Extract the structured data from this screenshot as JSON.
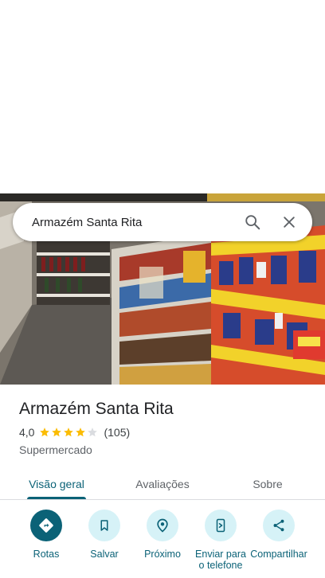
{
  "search": {
    "query": "Armazém Santa Rita",
    "search_icon": "search-icon",
    "close_icon": "close-icon"
  },
  "photo": {
    "icon": "store-photo"
  },
  "place": {
    "name": "Armazém Santa Rita",
    "rating": "4,0",
    "stars_value": 4.0,
    "stars_max": 5,
    "review_count": "(105)",
    "category": "Supermercado"
  },
  "tabs": [
    {
      "label": "Visão geral",
      "active": true
    },
    {
      "label": "Avaliações",
      "active": false
    },
    {
      "label": "Sobre",
      "active": false
    }
  ],
  "actions": [
    {
      "label": "Rotas",
      "icon": "directions-icon",
      "primary": true
    },
    {
      "label": "Salvar",
      "icon": "bookmark-icon",
      "primary": false
    },
    {
      "label": "Próximo",
      "icon": "nearby-icon",
      "primary": false
    },
    {
      "label": "Enviar para o telefone",
      "icon": "send-to-phone-icon",
      "primary": false
    },
    {
      "label": "Compartilhar",
      "icon": "share-icon",
      "primary": false
    }
  ],
  "colors": {
    "accent": "#0b6277",
    "accent_light": "#d6f2f7",
    "star": "#fbbc04",
    "star_empty": "#dadce0"
  }
}
